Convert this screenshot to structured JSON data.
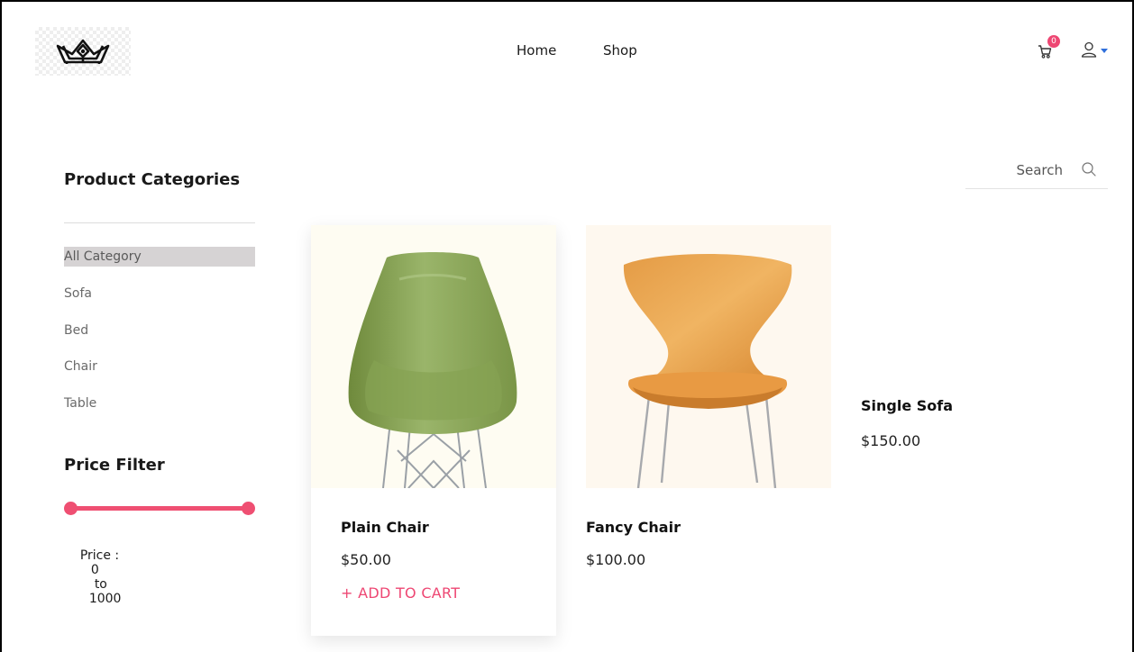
{
  "header": {
    "logo_icon": "crown-logo-icon",
    "nav": [
      {
        "label": "Home"
      },
      {
        "label": "Shop"
      }
    ],
    "cart": {
      "icon": "cart-icon",
      "count": "0",
      "badge_color": "#ee4773"
    },
    "user": {
      "icon": "user-icon",
      "caret_color": "#2f6fdb"
    }
  },
  "sidebar": {
    "categories_title": "Product Categories",
    "categories": [
      {
        "label": "All Category",
        "active": true
      },
      {
        "label": "Sofa",
        "active": false
      },
      {
        "label": "Bed",
        "active": false
      },
      {
        "label": "Chair",
        "active": false
      },
      {
        "label": "Table",
        "active": false
      }
    ],
    "price_filter": {
      "title": "Price Filter",
      "label": "Price :",
      "min": "0",
      "to": "to",
      "max": "1000",
      "accent": "#ef4f72"
    }
  },
  "search": {
    "placeholder": "Search",
    "icon": "search-icon"
  },
  "products": [
    {
      "name": "Plain Chair",
      "price": "$50.00",
      "action": "+ ADD TO CART",
      "image": "green-chair"
    },
    {
      "name": "Fancy Chair",
      "price": "$100.00",
      "image": "orange-chair"
    },
    {
      "name": "Single Sofa",
      "price": "$150.00"
    }
  ],
  "colors": {
    "accent": "#ee4773"
  }
}
